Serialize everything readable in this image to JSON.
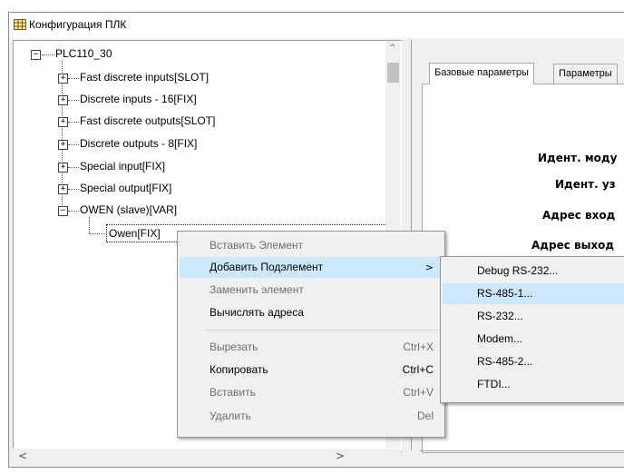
{
  "window": {
    "title": "Конфигурация ПЛК"
  },
  "tree": {
    "root": "PLC110_30",
    "items": [
      {
        "label": "Fast discrete inputs[SLOT]",
        "expander": "+"
      },
      {
        "label": "Discrete inputs - 16[FIX]",
        "expander": "+"
      },
      {
        "label": "Fast discrete outputs[SLOT]",
        "expander": "+"
      },
      {
        "label": "Discrete outputs - 8[FIX]",
        "expander": "+"
      },
      {
        "label": "Special input[FIX]",
        "expander": "+"
      },
      {
        "label": "Special output[FIX]",
        "expander": "+"
      },
      {
        "label": "OWEN (slave)[VAR]",
        "expander": "−"
      }
    ],
    "child": "Owen[FIX]",
    "root_expander": "−"
  },
  "scroll": {
    "up": "^",
    "down": "v",
    "left": "<",
    "right": ">"
  },
  "right_panel": {
    "tabs": [
      "Базовые параметры",
      "Параметры"
    ],
    "labels": [
      "Идент. моду",
      "Идент. уз",
      "Адрес вход",
      "Адрес выход"
    ]
  },
  "context_menu": {
    "items": [
      {
        "label": "Вставить Элемент",
        "shortcut": "",
        "disabled": true
      },
      {
        "label": "Добавить Подэлемент",
        "shortcut": "",
        "disabled": false,
        "submenu": ">"
      },
      {
        "label": "Заменить элемент",
        "shortcut": "",
        "disabled": true
      },
      {
        "label": "Вычислять адреса",
        "shortcut": "",
        "disabled": false
      },
      {
        "label": "Вырезать",
        "shortcut": "Ctrl+X",
        "disabled": true
      },
      {
        "label": "Копировать",
        "shortcut": "Ctrl+C",
        "disabled": false
      },
      {
        "label": "Вставить",
        "shortcut": "Ctrl+V",
        "disabled": true
      },
      {
        "label": "Удалить",
        "shortcut": "Del",
        "disabled": true
      }
    ]
  },
  "submenu": {
    "items": [
      "Debug RS-232...",
      "RS-485-1...",
      "RS-232...",
      "Modem...",
      "RS-485-2...",
      "FTDI..."
    ]
  },
  "colors": {
    "highlight": "#cce8ff",
    "disabled_text": "#6d6d6d"
  }
}
